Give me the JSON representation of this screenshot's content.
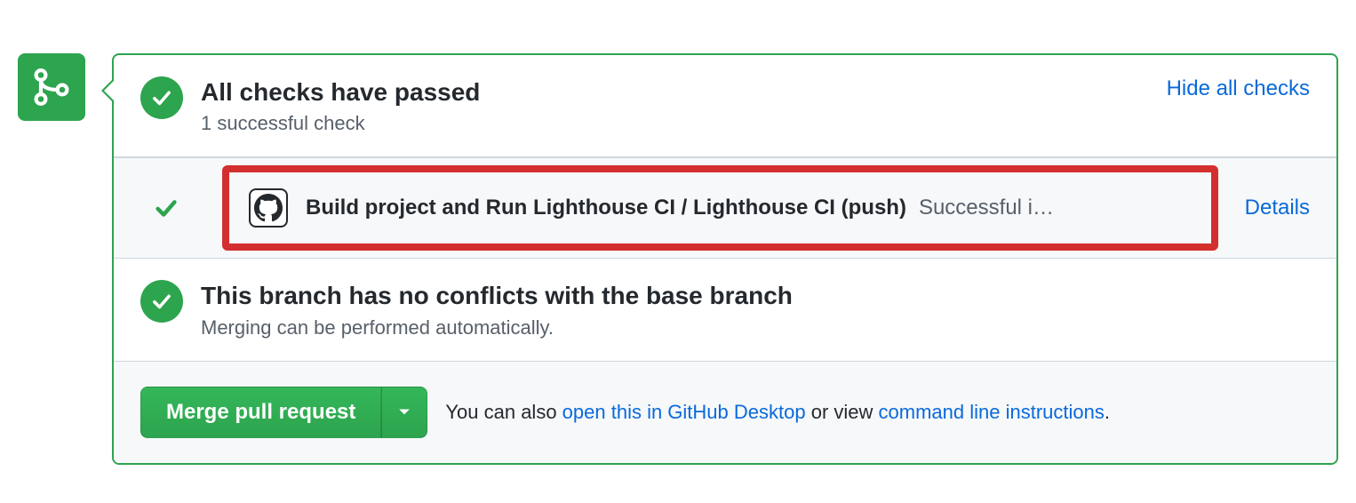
{
  "checks": {
    "title": "All checks have passed",
    "subtitle": "1 successful check",
    "toggle_link": "Hide all checks",
    "items": [
      {
        "name": "Build project and Run Lighthouse CI / Lighthouse CI (push)",
        "status": "Successful i…",
        "details_link": "Details"
      }
    ]
  },
  "conflicts": {
    "title": "This branch has no conflicts with the base branch",
    "subtitle": "Merging can be performed automatically."
  },
  "merge": {
    "button_label": "Merge pull request",
    "footer_prefix": "You can also ",
    "desktop_link": "open this in GitHub Desktop",
    "footer_mid": " or view ",
    "cli_link": "command line instructions",
    "footer_suffix": "."
  }
}
